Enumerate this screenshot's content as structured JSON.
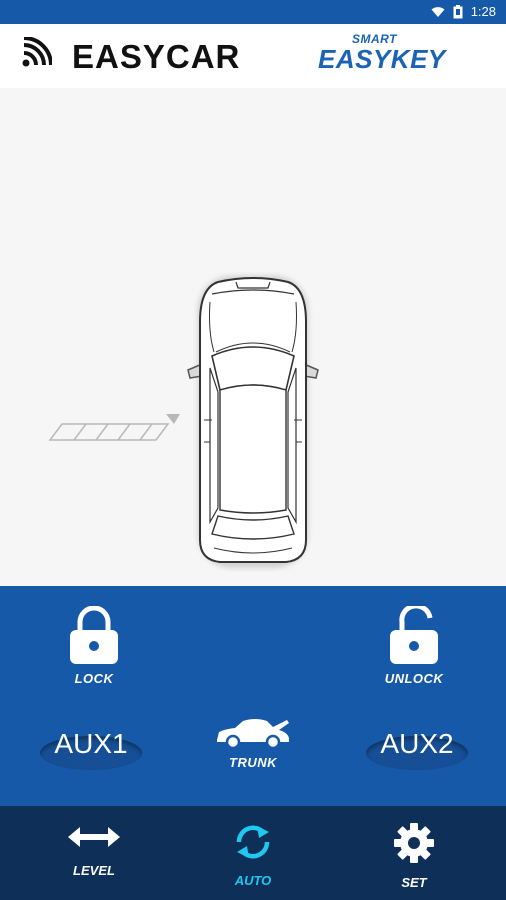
{
  "status_bar": {
    "time": "1:28"
  },
  "header": {
    "brand_left": "EASYCAR",
    "brand_right_top": "SMART",
    "brand_right_main": "EASYKEY"
  },
  "controls": {
    "lock_label": "LOCK",
    "unlock_label": "UNLOCK",
    "aux1_label": "AUX1",
    "aux2_label": "AUX2",
    "trunk_label": "TRUNK"
  },
  "bottom_nav": {
    "items": [
      {
        "label": "LEVEL",
        "icon": "left-right-arrow-icon",
        "active": false
      },
      {
        "label": "AUTO",
        "icon": "sync-icon",
        "active": true
      },
      {
        "label": "SET",
        "icon": "gear-icon",
        "active": false
      }
    ]
  },
  "colors": {
    "primary": "#1659a8",
    "nav_bg": "#0e2f58",
    "accent": "#1fc8f0",
    "brand_blue": "#1a63b6"
  }
}
